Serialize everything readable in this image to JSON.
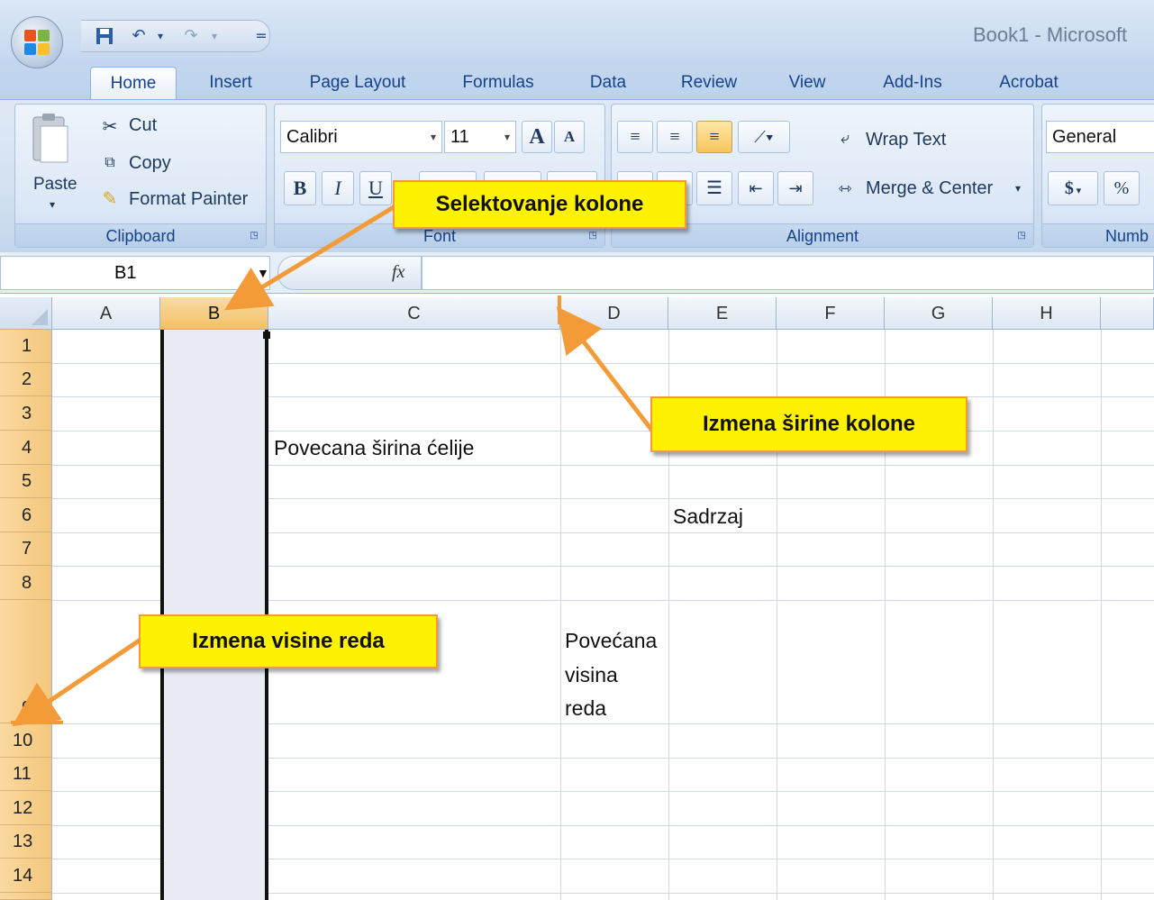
{
  "window": {
    "title": "Book1 - Microsoft"
  },
  "quick_access": {
    "icons": [
      "save-icon",
      "undo-icon",
      "redo-icon",
      "customize-qat-icon"
    ],
    "more": "=",
    "undo_dd": "▾"
  },
  "tabs": [
    "Home",
    "Insert",
    "Page Layout",
    "Formulas",
    "Data",
    "Review",
    "View",
    "Add-Ins",
    "Acrobat"
  ],
  "ribbon": {
    "clipboard": {
      "label": "Clipboard",
      "paste": "Paste",
      "cut": "Cut",
      "copy": "Copy",
      "format_painter": "Format Painter"
    },
    "font": {
      "label": "Font",
      "name": "Calibri",
      "size": "11",
      "bold": "B",
      "italic": "I",
      "underline": "U",
      "grow": "A",
      "shrink": "A"
    },
    "alignment": {
      "label": "Alignment",
      "wrap_text": "Wrap Text",
      "merge_center": "Merge & Center"
    },
    "number": {
      "label": "Numb",
      "format": "General",
      "currency": "$",
      "percent": "%"
    }
  },
  "formula_bar": {
    "name_box": "B1",
    "fx": "fx",
    "value": ""
  },
  "sheet": {
    "columns": [
      "A",
      "B",
      "C",
      "D",
      "E",
      "F",
      "G",
      "H"
    ],
    "rows": [
      "1",
      "2",
      "3",
      "4",
      "5",
      "6",
      "7",
      "8",
      "9",
      "10",
      "11",
      "12",
      "13",
      "14"
    ],
    "selected_column": "B",
    "cells": {
      "C4": "Povecana širina ćelije",
      "E6": "Sadrzaj",
      "D9_line1": "Povećana",
      "D9_line2": "visina",
      "D9_line3": "reda"
    }
  },
  "callouts": {
    "select_column": "Selektovanje kolone",
    "column_width": "Izmena širine kolone",
    "row_height": "Izmena visine reda"
  },
  "colors": {
    "callout_fill": "#fff200",
    "callout_border": "#f29b38",
    "arrow": "#f29b38",
    "selected_header": "#f4c77c"
  }
}
